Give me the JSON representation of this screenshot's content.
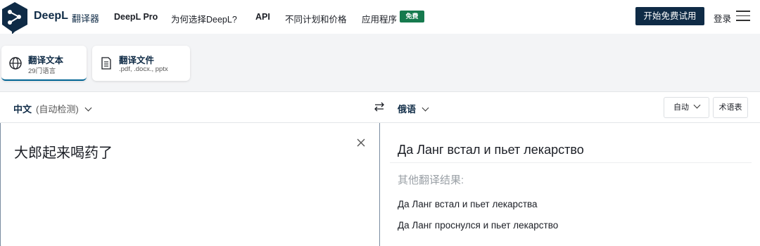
{
  "header": {
    "brand": "DeepL",
    "brand_sub": "翻译器",
    "nav": [
      "DeepL Pro",
      "为何选择DeepL?",
      "API",
      "不同计划和价格",
      "应用程序"
    ],
    "free_badge": "免费",
    "cta": "开始免费试用",
    "login": "登录"
  },
  "modes": [
    {
      "title": "翻译文本",
      "sub": "29门语言",
      "icon": "globe-icon"
    },
    {
      "title": "翻译文件",
      "sub": ".pdf, .docx., pptx",
      "icon": "document-icon"
    }
  ],
  "translator": {
    "source_lang": "中文",
    "source_detect": "(自动检测)",
    "target_lang": "俄语",
    "formality": "自动",
    "glossary": "术语表",
    "source_text": "大郎起来喝药了",
    "translation": "Да Ланг встал и пьет лекарство",
    "alternatives_heading": "其他翻译结果:",
    "alternatives": [
      "Да Ланг встал и пьет лекарства",
      "Да Ланг проснулся и пьет лекарство"
    ]
  },
  "colors": {
    "brand_navy": "#0f2b46",
    "free_badge": "#167a4e",
    "active_underline": "#006494"
  }
}
